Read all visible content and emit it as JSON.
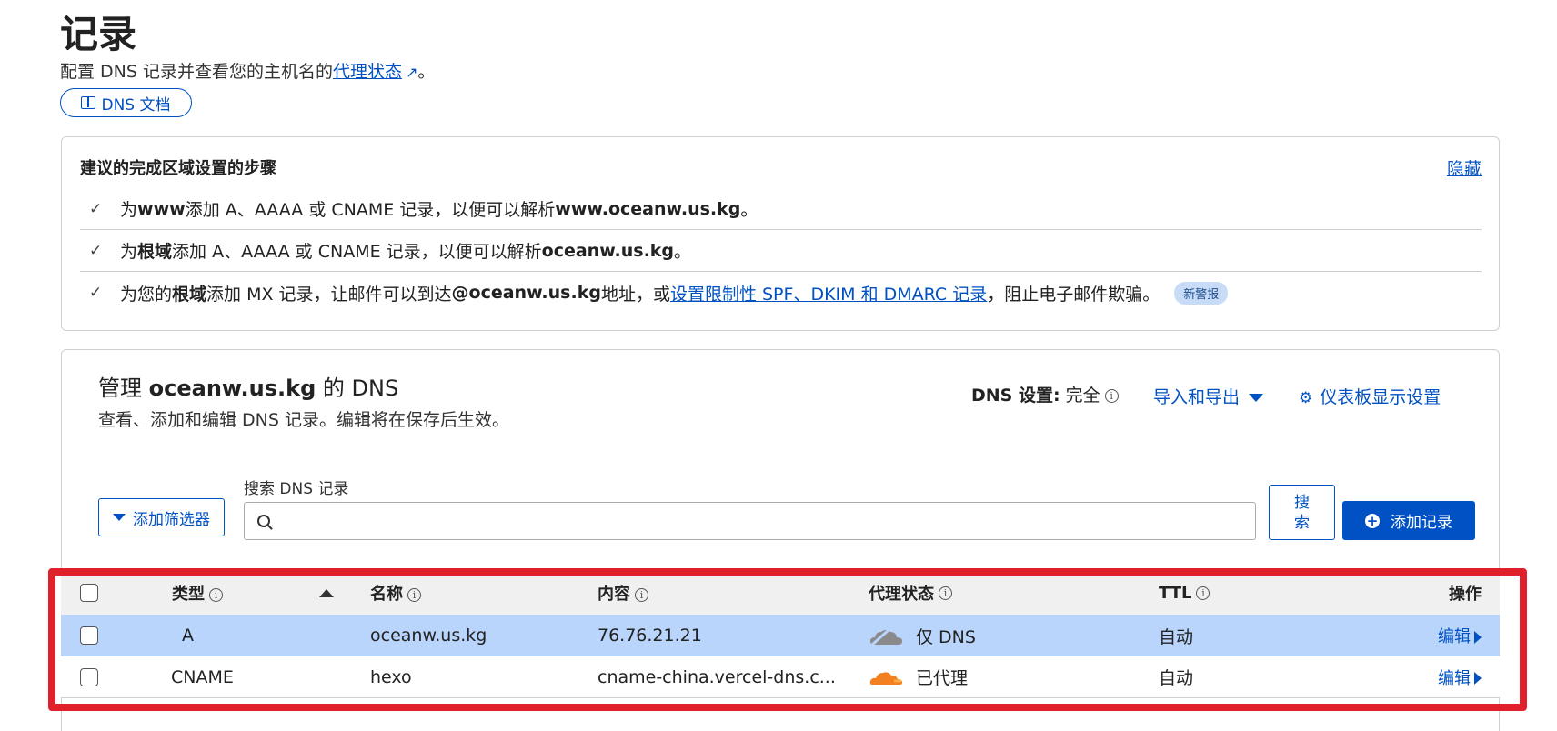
{
  "header": {
    "title": "记录",
    "desc_prefix": "配置 DNS 记录并查看您的主机名的",
    "desc_link": "代理状态",
    "desc_suffix": "。",
    "doc_button": "DNS 文档"
  },
  "steps": {
    "title": "建议的完成区域设置的步骤",
    "hide_link": "隐藏",
    "items": [
      {
        "a": "为 ",
        "b": "www",
        "c": " 添加 A、AAAA 或 CNAME 记录，以便可以解析 ",
        "d": "www.oceanw.us.kg",
        "e": "。"
      },
      {
        "a": "为",
        "b": "根域",
        "c": "添加 A、AAAA 或 CNAME 记录，以便可以解析 ",
        "d": "oceanw.us.kg",
        "e": "。"
      }
    ],
    "item3": {
      "a": "为您的",
      "b": "根域",
      "c": "添加 MX 记录，让邮件可以到达 ",
      "d": "@oceanw.us.kg",
      "e": " 地址，或",
      "link": "设置限制性 SPF、DKIM 和 DMARC 记录",
      "f": "，阻止电子邮件欺骗。",
      "badge": "新警报"
    }
  },
  "dns": {
    "title_prefix": "管理 ",
    "title_domain": "oceanw.us.kg",
    "title_suffix": " 的 DNS",
    "subtitle": "查看、添加和编辑 DNS 记录。编辑将在保存后生效。",
    "settings_label": "DNS 设置:",
    "settings_value": "完全",
    "import_export": "导入和导出",
    "dashboard_settings": "仪表板显示设置",
    "filter_button": "添加筛选器",
    "search_label": "搜索 DNS 记录",
    "search_value": "",
    "search_button": "搜索",
    "add_button": "添加记录"
  },
  "table": {
    "headers": {
      "type": "类型",
      "name": "名称",
      "content": "内容",
      "proxy": "代理状态",
      "ttl": "TTL",
      "ops": "操作"
    },
    "rows": [
      {
        "type": "A",
        "name": "oceanw.us.kg",
        "content": "76.76.21.21",
        "proxy": "仅 DNS",
        "proxy_icon": "cloud-gray-icon",
        "ttl": "自动",
        "edit": "编辑"
      },
      {
        "type": "CNAME",
        "name": "hexo",
        "content": "cname-china.vercel-dns.c...",
        "proxy": "已代理",
        "proxy_icon": "cloud-orange-icon",
        "ttl": "自动",
        "edit": "编辑"
      }
    ]
  },
  "colors": {
    "accent": "#0051c3",
    "highlight": "#e0202b",
    "selected_row": "#b9d5fb",
    "proxied": "#f38020",
    "dns_only": "#8a8a8a"
  }
}
